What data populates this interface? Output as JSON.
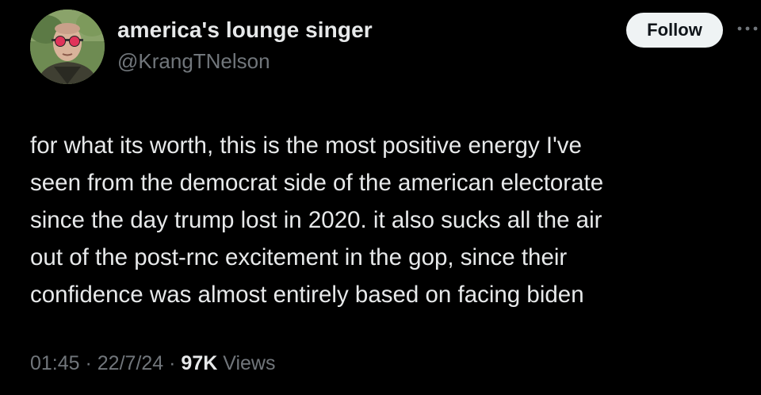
{
  "author": {
    "display_name": "america's lounge singer",
    "handle": "@KrangTNelson"
  },
  "actions": {
    "follow_label": "Follow",
    "more_icon": "more-horizontal-icon"
  },
  "tweet": {
    "lines": [
      "for what its worth, this is the most positive energy I've",
      "seen from the democrat side of the american electorate",
      "since the day trump lost in 2020. it also sucks all the air",
      "out of the post-rnc excitement in the gop, since their",
      "confidence was almost entirely based on facing biden"
    ]
  },
  "meta": {
    "time": "01:45",
    "separator": " · ",
    "date": "22/7/24",
    "views_count": "97K",
    "views_label": " Views"
  },
  "colors": {
    "background": "#000000",
    "text": "#e7e9ea",
    "secondary": "#71767b",
    "follow_bg": "#eff3f4"
  }
}
